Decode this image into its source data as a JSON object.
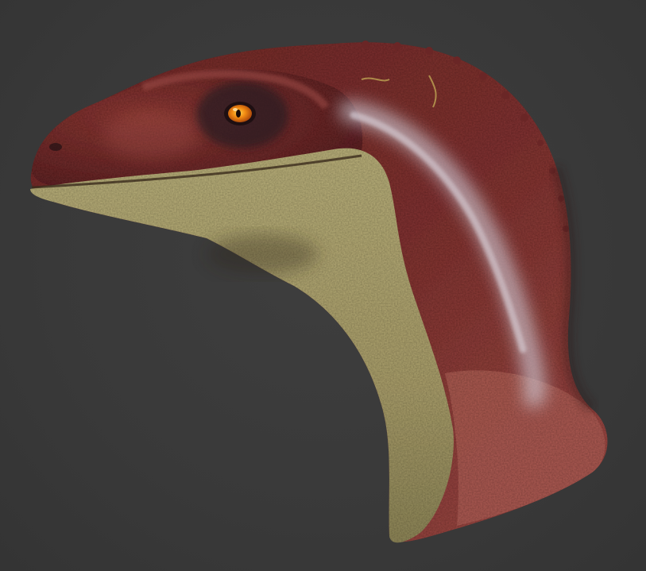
{
  "scene": {
    "subject": "raptor-head-sculpt",
    "background_color": "#3a3a3a",
    "palette": {
      "skin_red": "#7a2f2c",
      "skin_dark_red": "#4e1c1d",
      "skin_pink": "#a8564f",
      "belly_yellow": "#a9a070",
      "belly_light": "#c9c08e",
      "stripe_light": "#c8c4cf",
      "eye_orange": "#f08a10",
      "eye_pupil": "#1a0a05"
    }
  }
}
